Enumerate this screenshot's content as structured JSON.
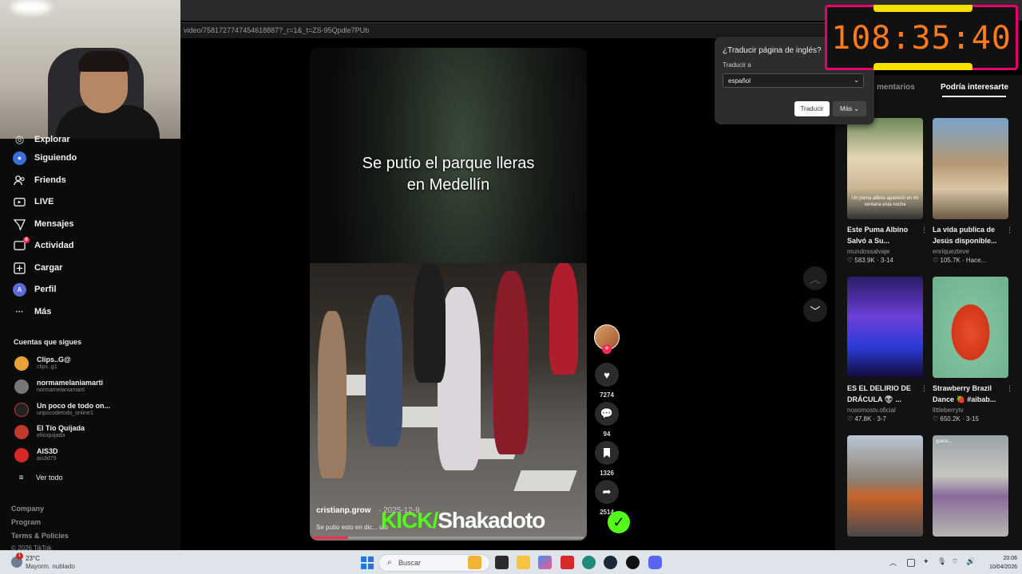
{
  "browser": {
    "url": "video/7581727747454618887?_r=1&_t=ZS-95Qpdle7PUb"
  },
  "nav": {
    "items": [
      {
        "label": "Explorar",
        "icon": "compass-icon"
      },
      {
        "label": "Siguiendo",
        "icon": "following-icon"
      },
      {
        "label": "Friends",
        "icon": "friends-icon"
      },
      {
        "label": "LIVE",
        "icon": "live-icon"
      },
      {
        "label": "Mensajes",
        "icon": "messages-icon"
      },
      {
        "label": "Actividad",
        "icon": "activity-icon",
        "badge": "8"
      },
      {
        "label": "Cargar",
        "icon": "upload-icon"
      },
      {
        "label": "Perfil",
        "icon": "profile-icon",
        "avatar_letter": "A"
      },
      {
        "label": "Más",
        "icon": "more-icon"
      }
    ],
    "following_title": "Cuentas que sigues",
    "following": [
      {
        "name": "Clips..G@",
        "handle": "clips..g1",
        "color": "#e8a23a"
      },
      {
        "name": "normamelaniamarti",
        "handle": "normamelaniamarti",
        "color": "#777777"
      },
      {
        "name": "Un poco de todo on...",
        "handle": "unpocodetodo_online1",
        "color": "#222222"
      },
      {
        "name": "El Tío Quijada",
        "handle": "eltioquijada",
        "color": "#c0392b"
      },
      {
        "name": "AIS3D",
        "handle": "ais3d79",
        "color": "#d62828"
      }
    ],
    "see_all": "Ver todo",
    "footer": [
      "Company",
      "Program",
      "Terms & Policies",
      "© 2026 TikTok"
    ]
  },
  "video": {
    "caption_line1": "Se putio el parque lleras",
    "caption_line2": "en Medellín",
    "author": "cristianp.grow",
    "date": "· 2025-12-9",
    "description": "Se putio esto en dic... ulo",
    "progress": 0.13
  },
  "actions": {
    "likes": "7274",
    "comments": "94",
    "saves": "1326",
    "shares": "2514"
  },
  "watermark": {
    "kick": "KICK/",
    "name": "Shakadoto",
    "check": "✓"
  },
  "translate_popup": {
    "title": "¿Traducir página de inglés?",
    "translate_to_label": "Traducir a",
    "selected_language": "español",
    "translate_button": "Traducir",
    "more_button": "Más"
  },
  "timer": {
    "value": "108:35:40"
  },
  "right_panel": {
    "tabs": [
      "mentarios",
      "Podría interesarte"
    ],
    "cards": [
      {
        "title": "Este Puma Albino Salvó a Su...",
        "author": "mundossalvaje",
        "stats": "♡ 583.9K · 3-14",
        "overlay": "Un puma albino apareció en mi ventana esta noche"
      },
      {
        "title": "La vida publica de Jesús disponible...",
        "author": "enriqueztevе",
        "stats": "♡ 105.7K · Hace...",
        "overlay": ""
      },
      {
        "title": "ES EL DELIRIO DE DRÁCULA 👽 ...",
        "author": "nosomostv.oficial",
        "stats": "♡ 47.8K · 3-7",
        "overlay": ""
      },
      {
        "title": "Strawberry Brazil Dance 🍓 #aibab...",
        "author": "littleberrytv",
        "stats": "♡ 650.2K · 3-15",
        "overlay": ""
      },
      {
        "title": "",
        "author": "",
        "stats": "",
        "overlay": ""
      },
      {
        "title": "",
        "author": "",
        "stats": "",
        "overlay": "quero..."
      }
    ]
  },
  "taskbar": {
    "temperature": "23°C",
    "weather": "Mayorm. nublado",
    "weather_badge": "1",
    "search_label": "Buscar",
    "time": "20:06",
    "date": "10/04/2026"
  }
}
